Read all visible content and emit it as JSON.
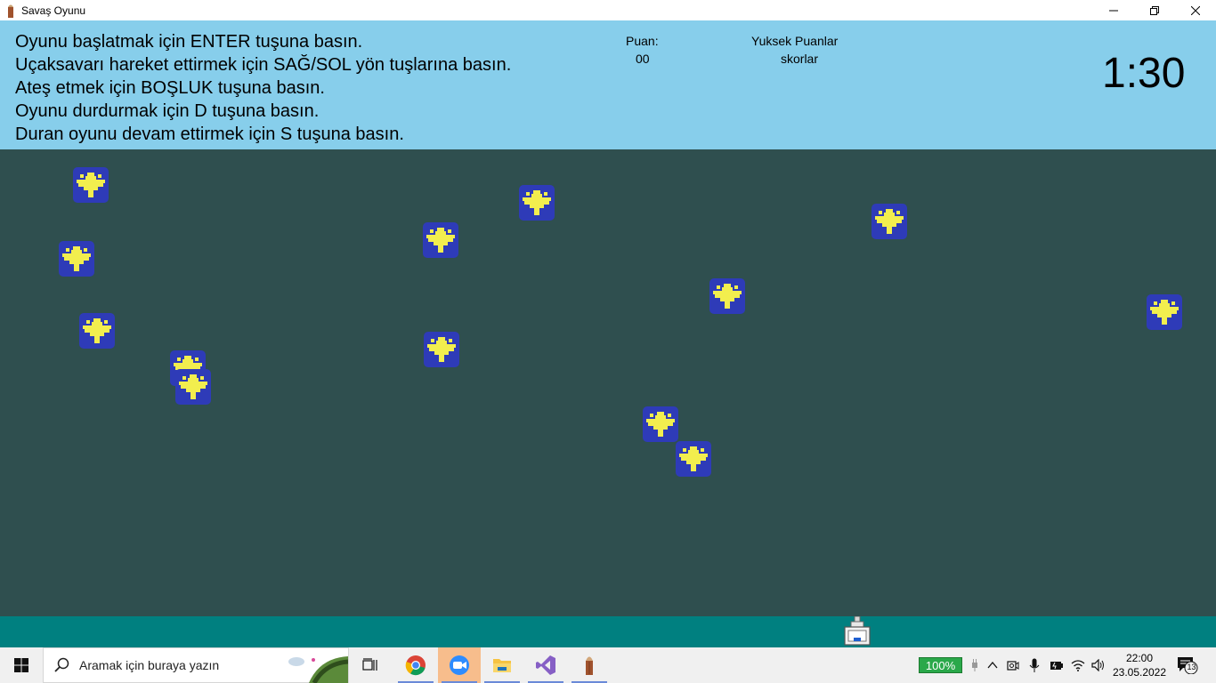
{
  "window": {
    "title": "Savaş Oyunu",
    "controls": [
      "minimize-icon",
      "restore-icon",
      "close-icon"
    ]
  },
  "info": {
    "instructions": [
      "Oyunu başlatmak için ENTER tuşuna basın.",
      "Uçaksavarı hareket ettirmek için SAĞ/SOL yön tuşlarına basın.",
      "Ateş etmek için BOŞLUK tuşuna basın.",
      "Oyunu durdurmak için D tuşuna basın.",
      "Duran oyunu devam ettirmek için S tuşuna basın."
    ],
    "score_label": "Puan:",
    "score_value": "00",
    "high_scores_label": "Yuksek Puanlar",
    "high_scores_value": "skorlar",
    "timer": "1:30"
  },
  "game": {
    "enemy_count": 14,
    "player": "anti-aircraft-gun"
  },
  "taskbar": {
    "search_placeholder": "Aramak için buraya yazın",
    "battery": "100%",
    "time": "22:00",
    "date": "23.05.2022",
    "notifications": "13"
  },
  "colors": {
    "info_bg": "#87ceeb",
    "game_bg": "#2f4f4f",
    "ground": "#008080",
    "plane_body": "#2e3bb8",
    "plane_wing": "#f2ee4e"
  }
}
